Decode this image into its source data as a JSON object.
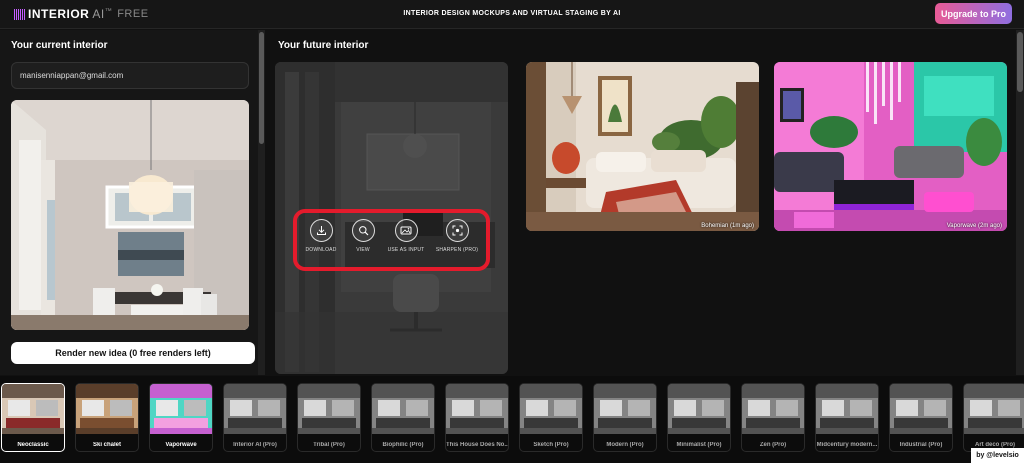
{
  "header": {
    "logo_main": "INTERIOR",
    "logo_ai": "AI",
    "logo_tm": "™",
    "logo_free": "FREE",
    "tagline": "INTERIOR DESIGN MOCKUPS AND VIRTUAL STAGING BY AI",
    "upgrade_label": "Upgrade to Pro",
    "upgrade_gradient": [
      "#e85b96",
      "#8f6ee0"
    ]
  },
  "left_panel": {
    "title": "Your current interior",
    "email_value": "manisenniappan@gmail.com",
    "render_button_label": "Render new idea (0 free renders left)"
  },
  "right_panel": {
    "title": "Your future interior",
    "actions": [
      {
        "label": "DOWNLOAD",
        "icon": "download-icon"
      },
      {
        "label": "VIEW",
        "icon": "magnifier-icon"
      },
      {
        "label": "USE AS INPUT",
        "icon": "image-input-icon"
      },
      {
        "label": "SHARPEN (PRO)",
        "icon": "sharpen-icon"
      }
    ],
    "renders": [
      {
        "label": "Bohemian (1m ago)"
      },
      {
        "label": "Vaporwave (2m ago)"
      }
    ],
    "highlight_color": "#e41b2c"
  },
  "styles": [
    {
      "label": "Neoclassic",
      "locked": false,
      "selected": true
    },
    {
      "label": "Ski chalet",
      "locked": false,
      "selected": false
    },
    {
      "label": "Vaporwave",
      "locked": false,
      "selected": false
    },
    {
      "label": "Interior AI (Pro)",
      "locked": true
    },
    {
      "label": "Tribal (Pro)",
      "locked": true
    },
    {
      "label": "Biophilic (Pro)",
      "locked": true
    },
    {
      "label": "This House Does No...",
      "locked": true
    },
    {
      "label": "Sketch (Pro)",
      "locked": true
    },
    {
      "label": "Modern (Pro)",
      "locked": true
    },
    {
      "label": "Minimalist (Pro)",
      "locked": true
    },
    {
      "label": "Zen (Pro)",
      "locked": true
    },
    {
      "label": "Midcentury modern...",
      "locked": true
    },
    {
      "label": "Industrial (Pro)",
      "locked": true
    },
    {
      "label": "Art deco (Pro)",
      "locked": true
    }
  ],
  "credit": "by @levelsio"
}
